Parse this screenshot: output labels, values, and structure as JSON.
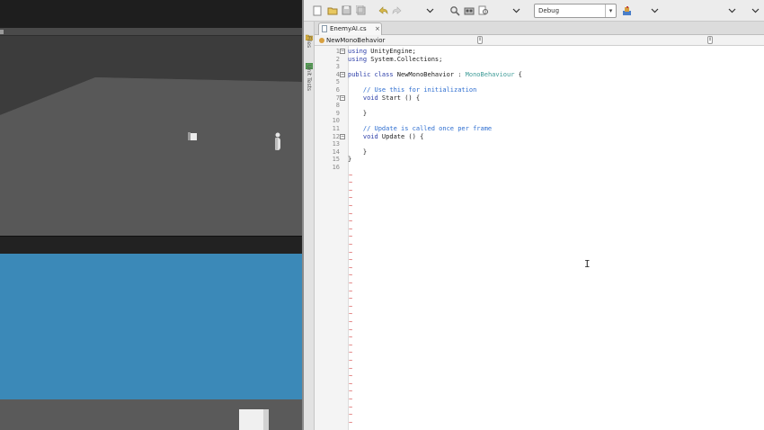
{
  "editor": {
    "tab_label": "EnemyAI.cs",
    "tab_close": "×",
    "class_selector": "NewMonoBehavior",
    "config": "Debug",
    "side_panels": [
      "Files",
      "Unit Tests"
    ],
    "code_lines": [
      [
        {
          "t": "using",
          "c": "kw"
        },
        {
          "t": " UnityEngine;"
        }
      ],
      [
        {
          "t": "using",
          "c": "kw"
        },
        {
          "t": " System.Collections;"
        }
      ],
      [],
      [
        {
          "t": "public class",
          "c": "kw"
        },
        {
          "t": " NewMonoBehavior : "
        },
        {
          "t": "MonoBehaviour",
          "c": "ty"
        },
        {
          "t": " {"
        }
      ],
      [],
      [
        {
          "t": "    // Use this for initialization",
          "c": "cm"
        }
      ],
      [
        {
          "t": "    "
        },
        {
          "t": "void",
          "c": "kw"
        },
        {
          "t": " Start () {"
        }
      ],
      [],
      [
        {
          "t": "    }"
        }
      ],
      [],
      [
        {
          "t": "    // Update is called once per frame",
          "c": "cm"
        }
      ],
      [
        {
          "t": "    "
        },
        {
          "t": "void",
          "c": "kw"
        },
        {
          "t": " Update () {"
        }
      ],
      [],
      [
        {
          "t": "    }"
        }
      ],
      [
        {
          "t": "}"
        }
      ],
      []
    ],
    "fold_lines": [
      1,
      4,
      7,
      12
    ],
    "tilde_char": "~",
    "tilde_rows": 33,
    "cursor_glyph": "I"
  },
  "colors": {
    "keyword": "#2c3ea8",
    "type": "#3d9b97",
    "comment": "#2e6ed0",
    "tilde": "#d44a4a",
    "game_view_sky": "#3b89b8"
  }
}
